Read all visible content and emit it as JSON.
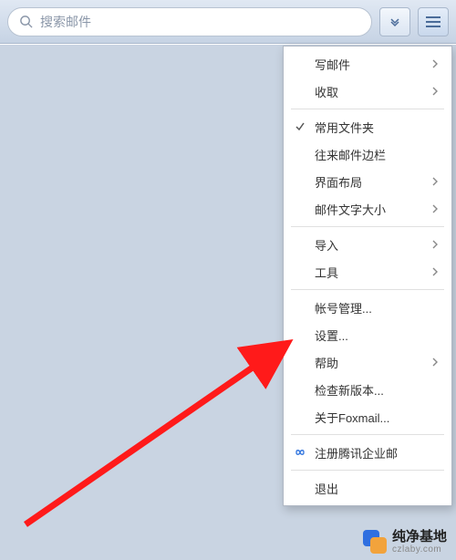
{
  "toolbar": {
    "search_placeholder": "搜索邮件"
  },
  "menu": {
    "items": [
      {
        "label": "写邮件",
        "submenu": true,
        "checked": false,
        "icon": ""
      },
      {
        "label": "收取",
        "submenu": true,
        "checked": false,
        "icon": ""
      },
      {
        "sep": true
      },
      {
        "label": "常用文件夹",
        "submenu": false,
        "checked": true,
        "icon": ""
      },
      {
        "label": "往来邮件边栏",
        "submenu": false,
        "checked": false,
        "icon": ""
      },
      {
        "label": "界面布局",
        "submenu": true,
        "checked": false,
        "icon": ""
      },
      {
        "label": "邮件文字大小",
        "submenu": true,
        "checked": false,
        "icon": ""
      },
      {
        "sep": true
      },
      {
        "label": "导入",
        "submenu": true,
        "checked": false,
        "icon": ""
      },
      {
        "label": "工具",
        "submenu": true,
        "checked": false,
        "icon": ""
      },
      {
        "sep": true
      },
      {
        "label": "帐号管理...",
        "submenu": false,
        "checked": false,
        "icon": ""
      },
      {
        "label": "设置...",
        "submenu": false,
        "checked": false,
        "icon": ""
      },
      {
        "label": "帮助",
        "submenu": true,
        "checked": false,
        "icon": ""
      },
      {
        "label": "检查新版本...",
        "submenu": false,
        "checked": false,
        "icon": ""
      },
      {
        "label": "关于Foxmail...",
        "submenu": false,
        "checked": false,
        "icon": ""
      },
      {
        "sep": true
      },
      {
        "label": "注册腾讯企业邮",
        "submenu": false,
        "checked": false,
        "icon": "infinity"
      },
      {
        "sep": true
      },
      {
        "label": "退出",
        "submenu": false,
        "checked": false,
        "icon": ""
      }
    ]
  },
  "watermark": {
    "main": "纯净基地",
    "sub": "czlaby.com"
  }
}
